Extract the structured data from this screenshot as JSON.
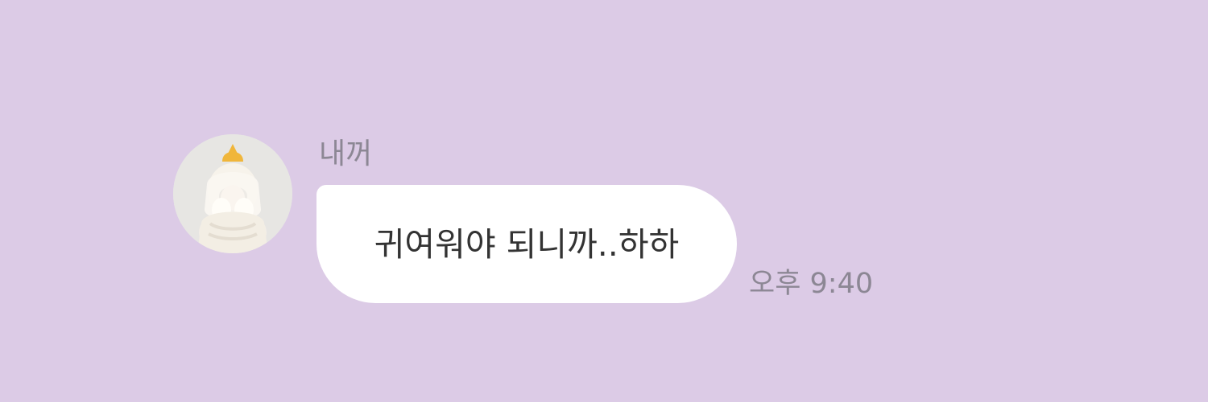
{
  "chat": {
    "sender_name": "내꺼",
    "message": "귀여워야 되니까..하하",
    "time": "오후 9:40",
    "avatar_icon": "profile-photo"
  },
  "colors": {
    "background": "#dccbe6",
    "bubble": "#ffffff",
    "name_text": "#8c8794",
    "message_text": "#333333",
    "time_text": "#8c8794"
  }
}
